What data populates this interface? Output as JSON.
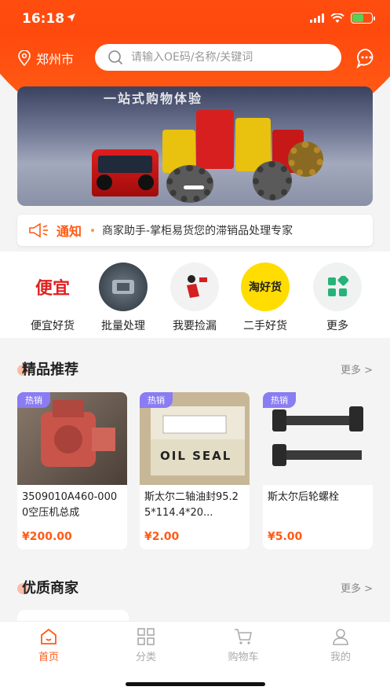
{
  "status": {
    "time": "16:18"
  },
  "topbar": {
    "city": "郑州市",
    "search_placeholder": "请输入OE码/名称/关键词"
  },
  "banner": {
    "title": "一站式购物体验"
  },
  "notice": {
    "label": "通知",
    "text": "商家助手-掌柜易货您的滞销品处理专家"
  },
  "shortcuts": [
    {
      "label": "便宜好货",
      "icon_text": "便宜",
      "icon": "cheap-goods-icon"
    },
    {
      "label": "批量处理",
      "icon_text": "",
      "icon": "bulk-process-icon"
    },
    {
      "label": "我要捡漏",
      "icon_text": "",
      "icon": "bargain-icon"
    },
    {
      "label": "二手好货",
      "icon_text": "淘好货",
      "icon": "secondhand-icon"
    },
    {
      "label": "更多",
      "icon_text": "",
      "icon": "more-apps-icon"
    }
  ],
  "featured": {
    "title": "精品推荐",
    "more": "更多 >",
    "products": [
      {
        "badge": "热销",
        "name": "3509010A460-0000空压机总成",
        "price": "¥200.00"
      },
      {
        "badge": "热销",
        "name": "斯太尔二轴油封95.25*114.4*20...",
        "price": "¥2.00",
        "img_text": "OIL SEAL"
      },
      {
        "badge": "热销",
        "name": "斯太尔后轮螺栓",
        "price": "¥5.00"
      }
    ]
  },
  "merchants": {
    "title": "优质商家",
    "more": "更多 >"
  },
  "tabs": [
    {
      "label": "首页",
      "active": true
    },
    {
      "label": "分类",
      "active": false
    },
    {
      "label": "购物车",
      "active": false
    },
    {
      "label": "我的",
      "active": false
    }
  ],
  "colors": {
    "accent": "#ff5a16",
    "badge": "#8a7cf2"
  }
}
